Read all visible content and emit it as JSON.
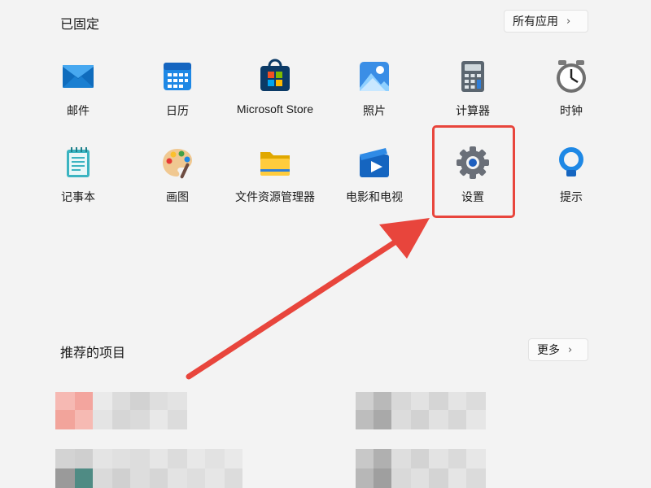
{
  "pinned": {
    "title": "已固定",
    "all_apps_label": "所有应用",
    "apps": [
      {
        "label": "邮件",
        "icon": "mail-icon"
      },
      {
        "label": "日历",
        "icon": "calendar-icon"
      },
      {
        "label": "Microsoft Store",
        "icon": "store-icon"
      },
      {
        "label": "照片",
        "icon": "photos-icon"
      },
      {
        "label": "计算器",
        "icon": "calculator-icon"
      },
      {
        "label": "时钟",
        "icon": "clock-icon"
      },
      {
        "label": "记事本",
        "icon": "notepad-icon"
      },
      {
        "label": "画图",
        "icon": "paint-icon"
      },
      {
        "label": "文件资源管理器",
        "icon": "folder-icon"
      },
      {
        "label": "电影和电视",
        "icon": "movies-icon"
      },
      {
        "label": "设置",
        "icon": "gear-icon"
      },
      {
        "label": "提示",
        "icon": "tips-icon"
      }
    ]
  },
  "recommended": {
    "title": "推荐的项目",
    "more_label": "更多"
  },
  "colors": {
    "background": "#f3f3f3",
    "highlight": "#e8453c",
    "arrow": "#e8453c"
  }
}
